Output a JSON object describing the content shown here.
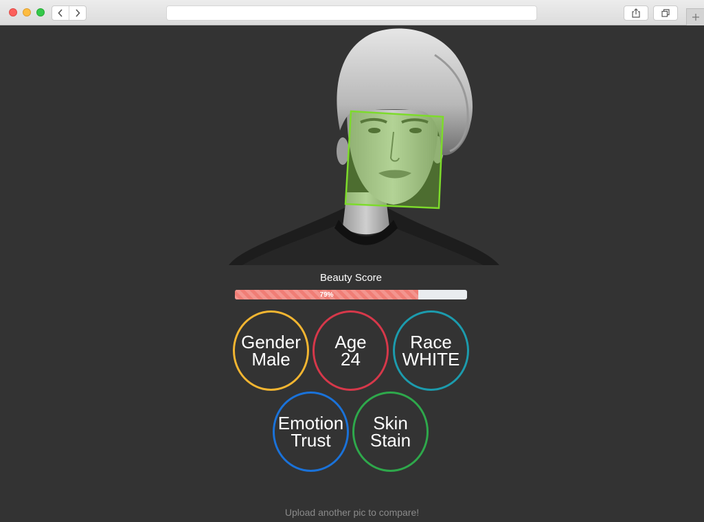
{
  "browser": {
    "url": "",
    "nav": {
      "back_icon": "chevron-left-icon",
      "forward_icon": "chevron-right-icon"
    },
    "toolbar": {
      "share_icon": "share-icon",
      "tabs_icon": "tabs-icon",
      "new_tab_icon": "plus-icon"
    }
  },
  "analysis": {
    "face_box_color": "#7ddb2b",
    "score": {
      "label": "Beauty Score",
      "value": 0.79,
      "text": "79%",
      "color": "#f07e76"
    },
    "attributes": [
      {
        "title": "Gender",
        "value": "Male",
        "color": "#f2b531"
      },
      {
        "title": "Age",
        "value": "24",
        "color": "#d6384a"
      },
      {
        "title": "Race",
        "value": "WHITE",
        "color": "#1c9bad"
      },
      {
        "title": "Emotion",
        "value": "Trust",
        "color": "#1a72d9"
      },
      {
        "title": "Skin",
        "value": "Stain",
        "color": "#2ea84b"
      }
    ]
  },
  "footer": {
    "text": "Upload another pic to compare!"
  }
}
